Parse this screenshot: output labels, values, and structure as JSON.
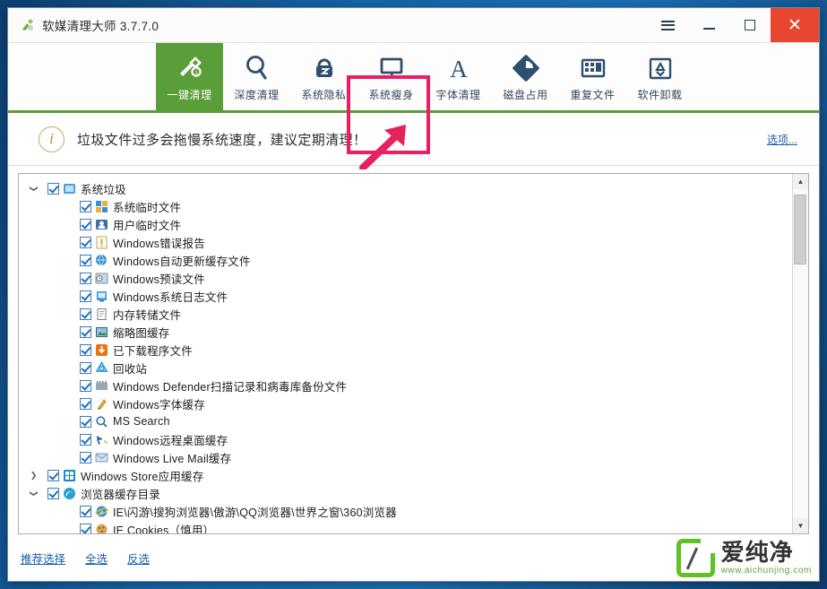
{
  "window": {
    "title": "软媒清理大师 3.7.7.0",
    "app_icon": "broom-leaf-icon",
    "controls": {
      "menu": "menu-hamburger",
      "minimize": "minimize",
      "maximize": "maximize",
      "close": "✕"
    }
  },
  "toolbar": {
    "items": [
      {
        "label": "一键清理",
        "icon": "brush-icon",
        "active": true
      },
      {
        "label": "深度清理",
        "icon": "magnifier-icon",
        "active": false
      },
      {
        "label": "系统隐私",
        "icon": "lock-icon",
        "active": false
      },
      {
        "label": "系统瘦身",
        "icon": "monitor-icon",
        "active": false
      },
      {
        "label": "字体清理",
        "icon": "letter-a-icon",
        "active": false
      },
      {
        "label": "磁盘占用",
        "icon": "disk-pie-icon",
        "active": false
      },
      {
        "label": "重复文件",
        "icon": "grid-files-icon",
        "active": false
      },
      {
        "label": "软件卸载",
        "icon": "recycle-box-icon",
        "active": false
      }
    ],
    "highlight_target": "系统瘦身",
    "highlight_color": "#ea1e63",
    "active_color": "#5a9e39"
  },
  "notice": {
    "icon": "info-circle-icon",
    "text": "垃圾文件过多会拖慢系统速度，建议定期清理！",
    "options_link": "选项...",
    "arrow_color": "#e6215c"
  },
  "tree": {
    "rows": [
      {
        "label": "系统垃圾",
        "level": 0,
        "checked": true,
        "expander": "▼",
        "icon": "system-trash-icon"
      },
      {
        "label": "系统临时文件",
        "level": 1,
        "checked": true,
        "expander": "",
        "icon": "temp-file-icon"
      },
      {
        "label": "用户临时文件",
        "level": 1,
        "checked": true,
        "expander": "",
        "icon": "user-temp-icon"
      },
      {
        "label": "Windows错误报告",
        "level": 1,
        "checked": true,
        "expander": "",
        "icon": "warning-icon"
      },
      {
        "label": "Windows自动更新缓存文件",
        "level": 1,
        "checked": true,
        "expander": "",
        "icon": "update-globe-icon"
      },
      {
        "label": "Windows预读文件",
        "level": 1,
        "checked": true,
        "expander": "",
        "icon": "prefetch-icon"
      },
      {
        "label": "Windows系统日志文件",
        "level": 1,
        "checked": true,
        "expander": "",
        "icon": "log-screen-icon"
      },
      {
        "label": "内存转储文件",
        "level": 1,
        "checked": true,
        "expander": "",
        "icon": "dump-doc-icon"
      },
      {
        "label": "缩略图缓存",
        "level": 1,
        "checked": true,
        "expander": "",
        "icon": "thumbnail-icon"
      },
      {
        "label": "已下载程序文件",
        "level": 1,
        "checked": true,
        "expander": "",
        "icon": "download-icon"
      },
      {
        "label": "回收站",
        "level": 1,
        "checked": true,
        "expander": "",
        "icon": "recycle-icon"
      },
      {
        "label": "Windows Defender扫描记录和病毒库备份文件",
        "level": 1,
        "checked": true,
        "expander": "",
        "icon": "defender-icon"
      },
      {
        "label": "Windows字体缓存",
        "level": 1,
        "checked": true,
        "expander": "",
        "icon": "font-cache-icon"
      },
      {
        "label": "MS Search",
        "level": 1,
        "checked": true,
        "expander": "",
        "icon": "search-icon"
      },
      {
        "label": "Windows远程桌面缓存",
        "level": 1,
        "checked": true,
        "expander": "",
        "icon": "remote-desktop-icon"
      },
      {
        "label": "Windows Live Mail缓存",
        "level": 1,
        "checked": true,
        "expander": "",
        "icon": "mail-icon"
      },
      {
        "label": "Windows Store应用缓存",
        "level": 0,
        "checked": true,
        "expander": "›",
        "icon": "store-icon"
      },
      {
        "label": "浏览器缓存目录",
        "level": 0,
        "checked": true,
        "expander": "▼",
        "icon": "edge-icon"
      },
      {
        "label": "IE\\闪游\\搜狗浏览器\\傲游\\QQ浏览器\\世界之窗\\360浏览器",
        "level": 1,
        "checked": true,
        "expander": "",
        "icon": "ie-icon"
      },
      {
        "label": "IE Cookies（慎用）",
        "level": 1,
        "checked": true,
        "expander": "",
        "icon": "cookie-icon"
      }
    ],
    "scrollbar": {
      "up": "▲",
      "down": "▼"
    }
  },
  "bottom": {
    "links": [
      "推荐选择",
      "全选",
      "反选"
    ]
  },
  "watermark": {
    "brand": "爱纯净",
    "url": "www.aichunjing.com",
    "color": "#62c126"
  }
}
